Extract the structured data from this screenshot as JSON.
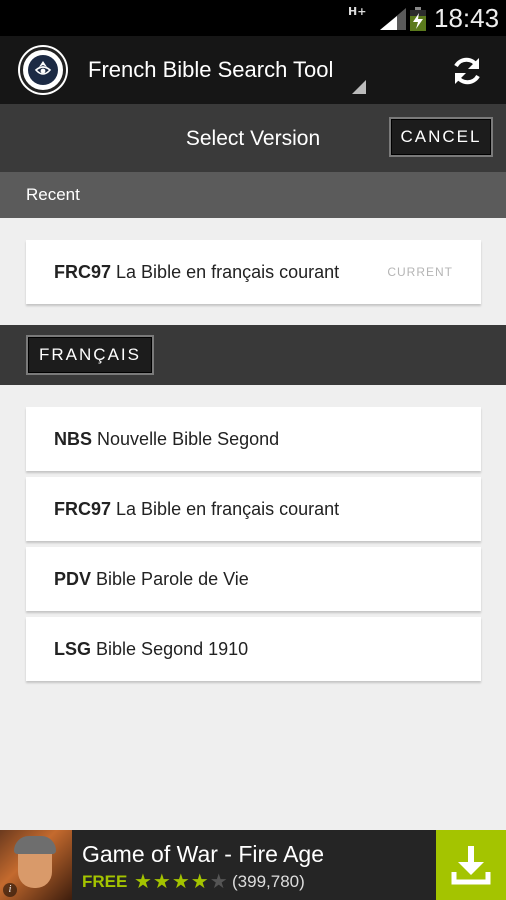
{
  "status_bar": {
    "network": "H+",
    "time": "18:43",
    "icons": [
      "signal-icon",
      "battery-charging-icon"
    ]
  },
  "action_bar": {
    "title": "French Bible Search Tool",
    "icons": [
      "app-logo-icon",
      "refresh-icon"
    ]
  },
  "select_bar": {
    "title": "Select Version",
    "cancel_label": "CANCEL"
  },
  "recent": {
    "header": "Recent",
    "items": [
      {
        "code": "FRC97",
        "name": "La Bible en français courant",
        "badge": "CURRENT"
      }
    ]
  },
  "language": {
    "label": "FRANÇAIS",
    "items": [
      {
        "code": "NBS",
        "name": "Nouvelle Bible Segond"
      },
      {
        "code": "FRC97",
        "name": "La Bible en français courant"
      },
      {
        "code": "PDV",
        "name": "Bible Parole de Vie"
      },
      {
        "code": "LSG",
        "name": "Bible Segond 1910"
      }
    ]
  },
  "ad": {
    "title": "Game of War - Fire Age",
    "price": "FREE",
    "rating": 4,
    "rating_max": 5,
    "review_count": "(399,780)",
    "accent_color": "#a4c400",
    "icons": [
      "download-icon"
    ]
  }
}
